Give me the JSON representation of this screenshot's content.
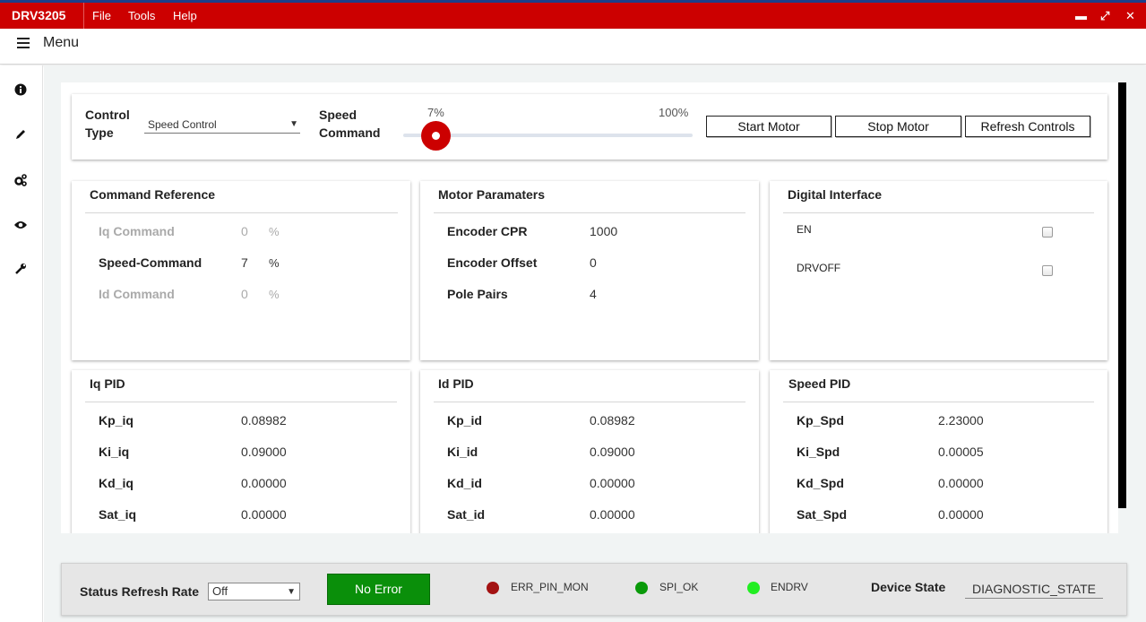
{
  "titlebar": {
    "app_name": "DRV3205",
    "menu": [
      "File",
      "Tools",
      "Help"
    ],
    "window_controls": {
      "minimize": "▬",
      "maximize": "⤢",
      "close": "✕"
    }
  },
  "menubar": {
    "label": "Menu"
  },
  "sidenav": [
    "info-icon",
    "pencil-icon",
    "gears-icon",
    "eye-icon",
    "wrench-icon"
  ],
  "control": {
    "control_type_label_1": "Control",
    "control_type_label_2": "Type",
    "control_type_value": "Speed Control",
    "dropdown_arrow": "▼",
    "speed_label_1": "Speed",
    "speed_label_2": "Command",
    "slider_value_label": "7%",
    "slider_max_label": "100%",
    "slider_value_fraction": 0.07,
    "buttons": {
      "start": "Start Motor",
      "stop": "Stop Motor",
      "refresh": "Refresh Controls"
    }
  },
  "command_reference": {
    "title": "Command Reference",
    "rows": [
      {
        "label": "Iq Command",
        "value": "0",
        "unit": "%"
      },
      {
        "label": "Speed-Command",
        "value": "7",
        "unit": "%"
      },
      {
        "label": "Id Command",
        "value": "0",
        "unit": "%"
      }
    ]
  },
  "motor_parameters": {
    "title": "Motor Paramaters",
    "rows": [
      {
        "label": "Encoder CPR",
        "value": "1000"
      },
      {
        "label": "Encoder Offset",
        "value": "0"
      },
      {
        "label": "Pole Pairs",
        "value": "4"
      }
    ]
  },
  "digital_interface": {
    "title": "Digital Interface",
    "items": [
      {
        "label": "EN",
        "checked": false
      },
      {
        "label": "DRVOFF",
        "checked": false
      }
    ]
  },
  "iq_pid": {
    "title": "Iq PID",
    "rows": [
      {
        "label": "Kp_iq",
        "value": "0.08982"
      },
      {
        "label": "Ki_iq",
        "value": "0.09000"
      },
      {
        "label": "Kd_iq",
        "value": "0.00000"
      },
      {
        "label": "Sat_iq",
        "value": "0.00000"
      }
    ]
  },
  "id_pid": {
    "title": "Id PID",
    "rows": [
      {
        "label": "Kp_id",
        "value": "0.08982"
      },
      {
        "label": "Ki_id",
        "value": "0.09000"
      },
      {
        "label": "Kd_id",
        "value": "0.00000"
      },
      {
        "label": "Sat_id",
        "value": "0.00000"
      }
    ]
  },
  "speed_pid": {
    "title": "Speed PID",
    "rows": [
      {
        "label": "Kp_Spd",
        "value": "2.23000"
      },
      {
        "label": "Ki_Spd",
        "value": "0.00005"
      },
      {
        "label": "Kd_Spd",
        "value": "0.00000"
      },
      {
        "label": "Sat_Spd",
        "value": "0.00000"
      }
    ]
  },
  "status": {
    "refresh_rate_label": "Status Refresh Rate",
    "refresh_rate_value": "Off",
    "dropdown_arrow": "▼",
    "error_status": "No Error",
    "indicators": [
      {
        "label": "ERR_PIN_MON",
        "color": "#a31212"
      },
      {
        "label": "SPI_OK",
        "color": "#0a9a0a"
      },
      {
        "label": "ENDRV",
        "color": "#22ee22"
      }
    ],
    "device_state_label": "Device State",
    "device_state_value": "DIAGNOSTIC_STATE"
  },
  "colors": {
    "brand_red": "#cc0000",
    "ok_green": "#0a8f0a"
  }
}
